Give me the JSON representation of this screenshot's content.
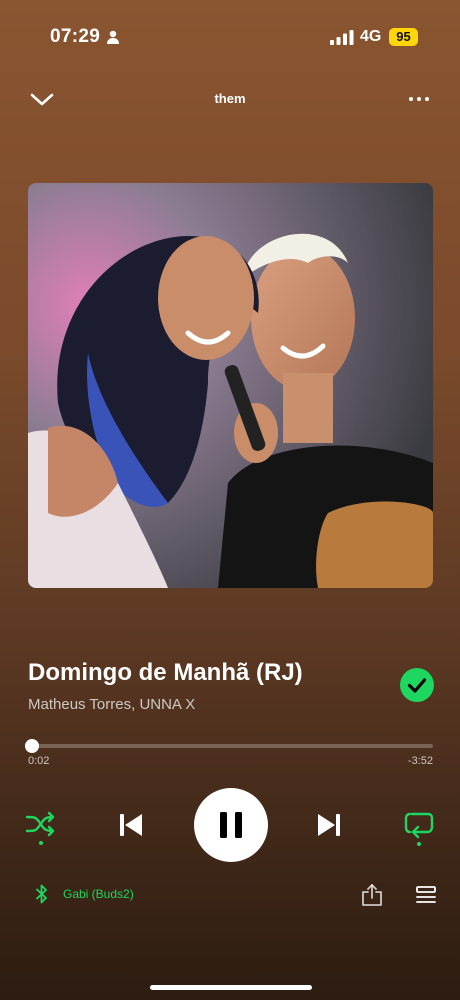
{
  "status_bar": {
    "time": "07:29",
    "network": "4G",
    "battery": "95",
    "icons": [
      "person-icon",
      "signal-icon"
    ]
  },
  "header": {
    "title": "them",
    "icons": [
      "chevron-down-icon",
      "more-icon"
    ]
  },
  "album_art": {
    "icon": "album-art-image"
  },
  "track": {
    "title": "Domingo de Manhã (RJ)",
    "artists": "Matheus Torres, UNNA X",
    "liked": true
  },
  "progress": {
    "elapsed": "0:02",
    "remaining": "-3:52",
    "fraction": 0.009
  },
  "controls": {
    "shuffle_active": true,
    "repeat_active": true,
    "playing": true,
    "icons": [
      "shuffle-icon",
      "previous-icon",
      "pause-icon",
      "next-icon",
      "repeat-icon"
    ]
  },
  "device": {
    "name": "Gabi (Buds2)",
    "icon": "bluetooth-icon"
  },
  "bottom_actions": [
    "share-icon",
    "queue-icon"
  ],
  "colors": {
    "accent": "#1ed760",
    "background_top": "#8a5531",
    "background_bottom": "#2c1c12",
    "battery": "#ffd60a"
  }
}
